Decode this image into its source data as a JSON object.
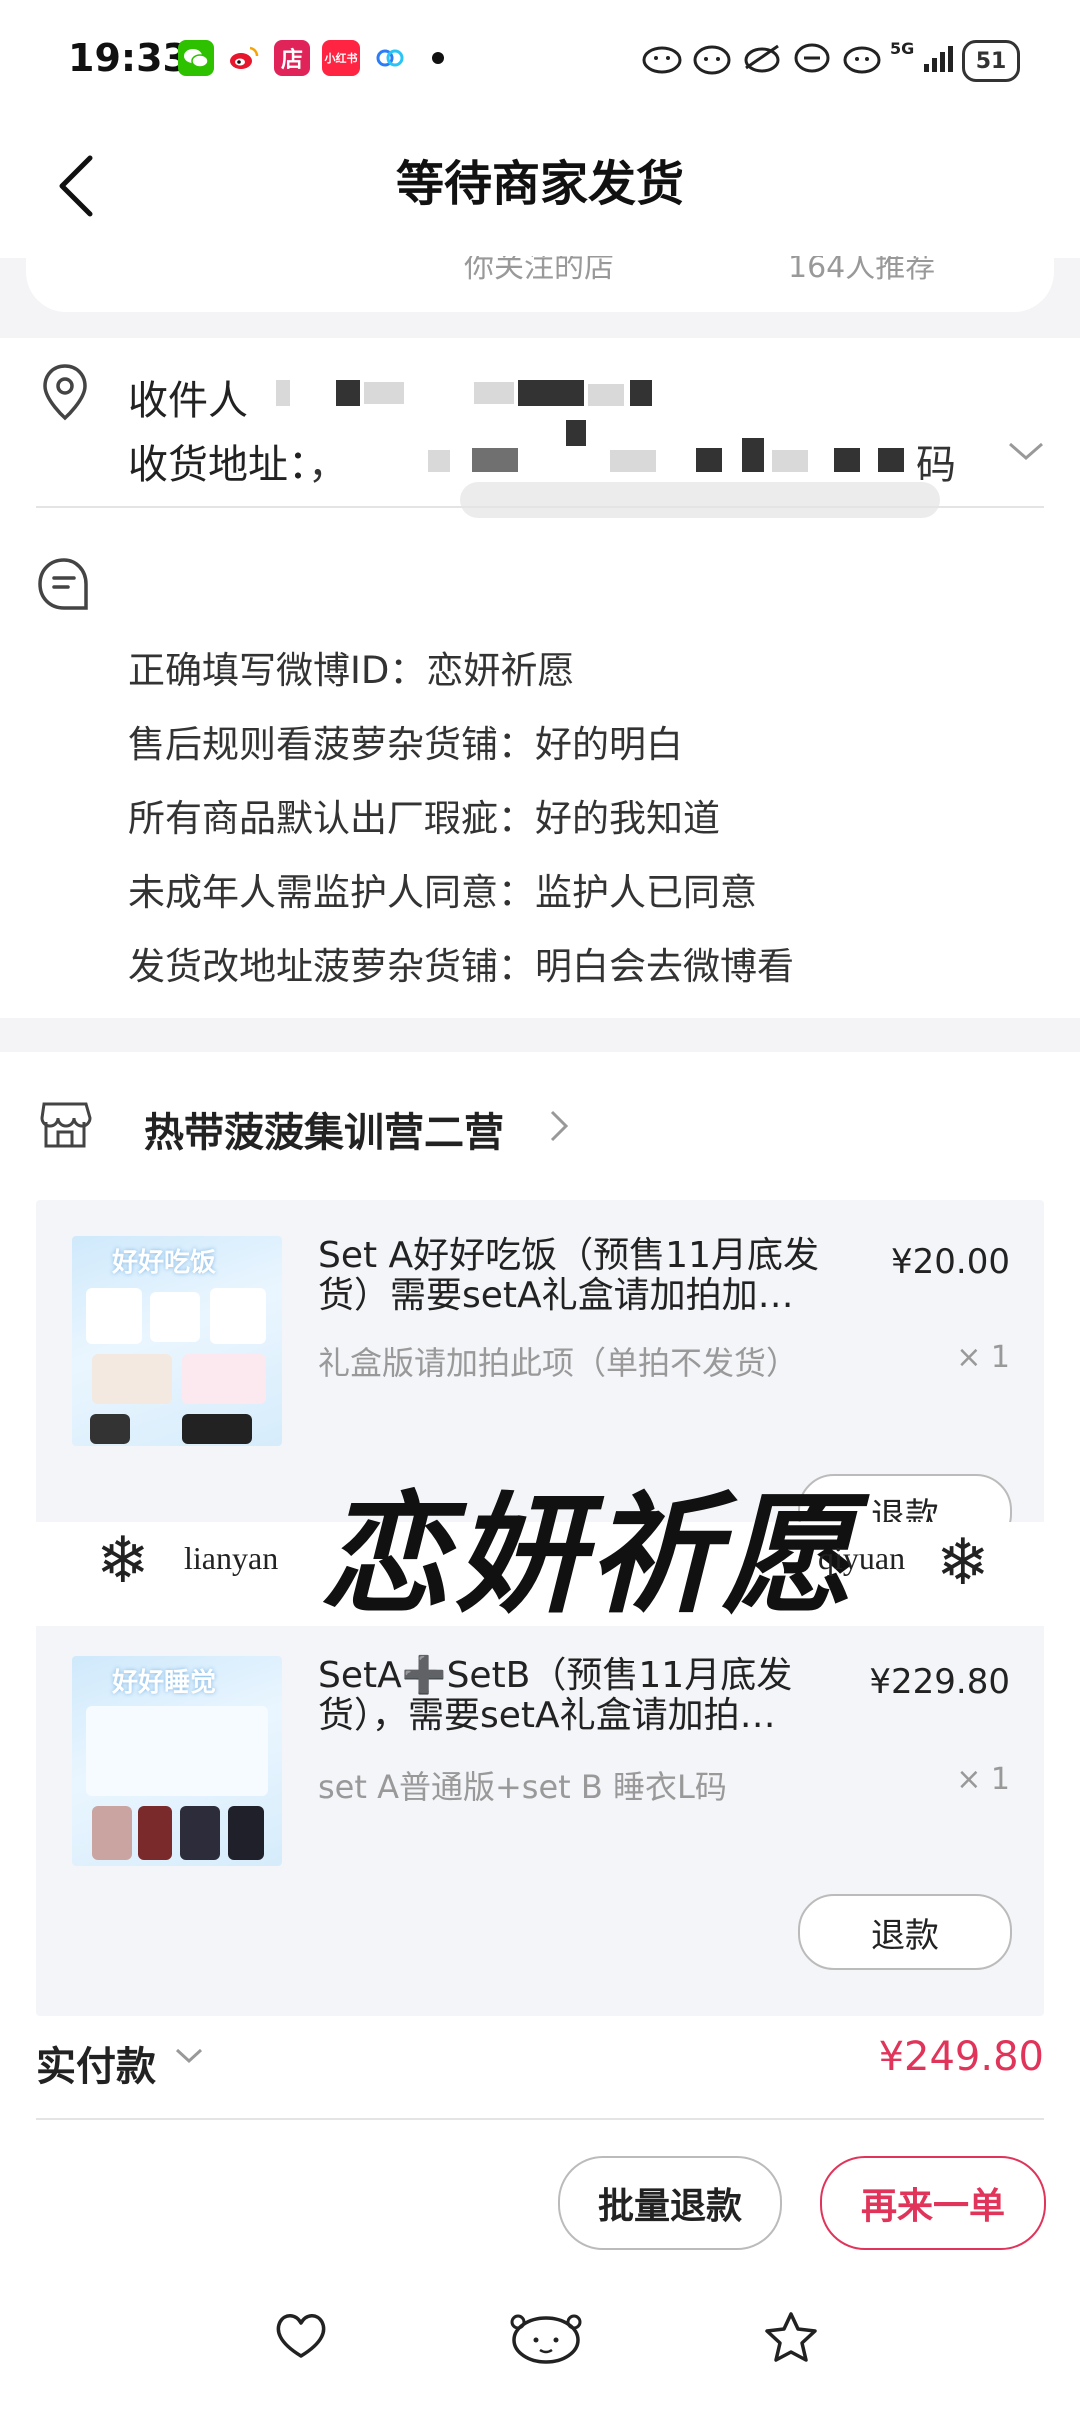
{
  "status_bar": {
    "time": "19:33",
    "app_icons": [
      "wechat-icon",
      "weibo-icon",
      "store-icon",
      "xiaohongshu-icon",
      "baidu-cloud-icon"
    ],
    "store_label": "店",
    "xhs_label": "小红书",
    "network": "5G",
    "battery": "51"
  },
  "header": {
    "title": "等待商家发货"
  },
  "top_card": {
    "left_text": "你关注的店",
    "right_text": "164人推荐"
  },
  "address": {
    "recipient_label": "收件人",
    "address_label": "收货地址：",
    "address_tail": "码"
  },
  "notes": [
    "正确填写微博ID：恋妍祈愿",
    "售后规则看菠萝杂货铺：好的明白",
    "所有商品默认出厂瑕疵：好的我知道",
    "未成年人需监护人同意：监护人已同意",
    "发货改地址菠萝杂货铺：明白会去微博看"
  ],
  "shop": {
    "name": "热带菠菠集训营二营"
  },
  "items": [
    {
      "name": "Set A好好吃饭（预售11月底发货）需要setA礼盒请加拍加…",
      "spec": "礼盒版请加拍此项（单拍不发货）",
      "price": "¥20.00",
      "qty": "× 1",
      "refund_label": "退款",
      "thumb_title": "好好吃饭"
    },
    {
      "name": "SetA➕SetB（预售11月底发货），需要setA礼盒请加拍…",
      "spec": "set A普通版+set B 睡衣L码",
      "price": "¥229.80",
      "qty": "× 1",
      "refund_label": "退款",
      "thumb_title": "好好睡觉"
    }
  ],
  "watermark": {
    "main": "恋妍祈愿",
    "left": "lianyan",
    "right": "qiyuan"
  },
  "total": {
    "label": "实付款",
    "value": "¥249.80"
  },
  "actions": {
    "batch_refund": "批量退款",
    "reorder": "再来一单"
  },
  "bottom_nav": [
    "heart-icon",
    "face-icon",
    "star-icon"
  ],
  "colors": {
    "accent": "#e0345a",
    "background": "#f4f4f6",
    "card": "#ffffff"
  }
}
